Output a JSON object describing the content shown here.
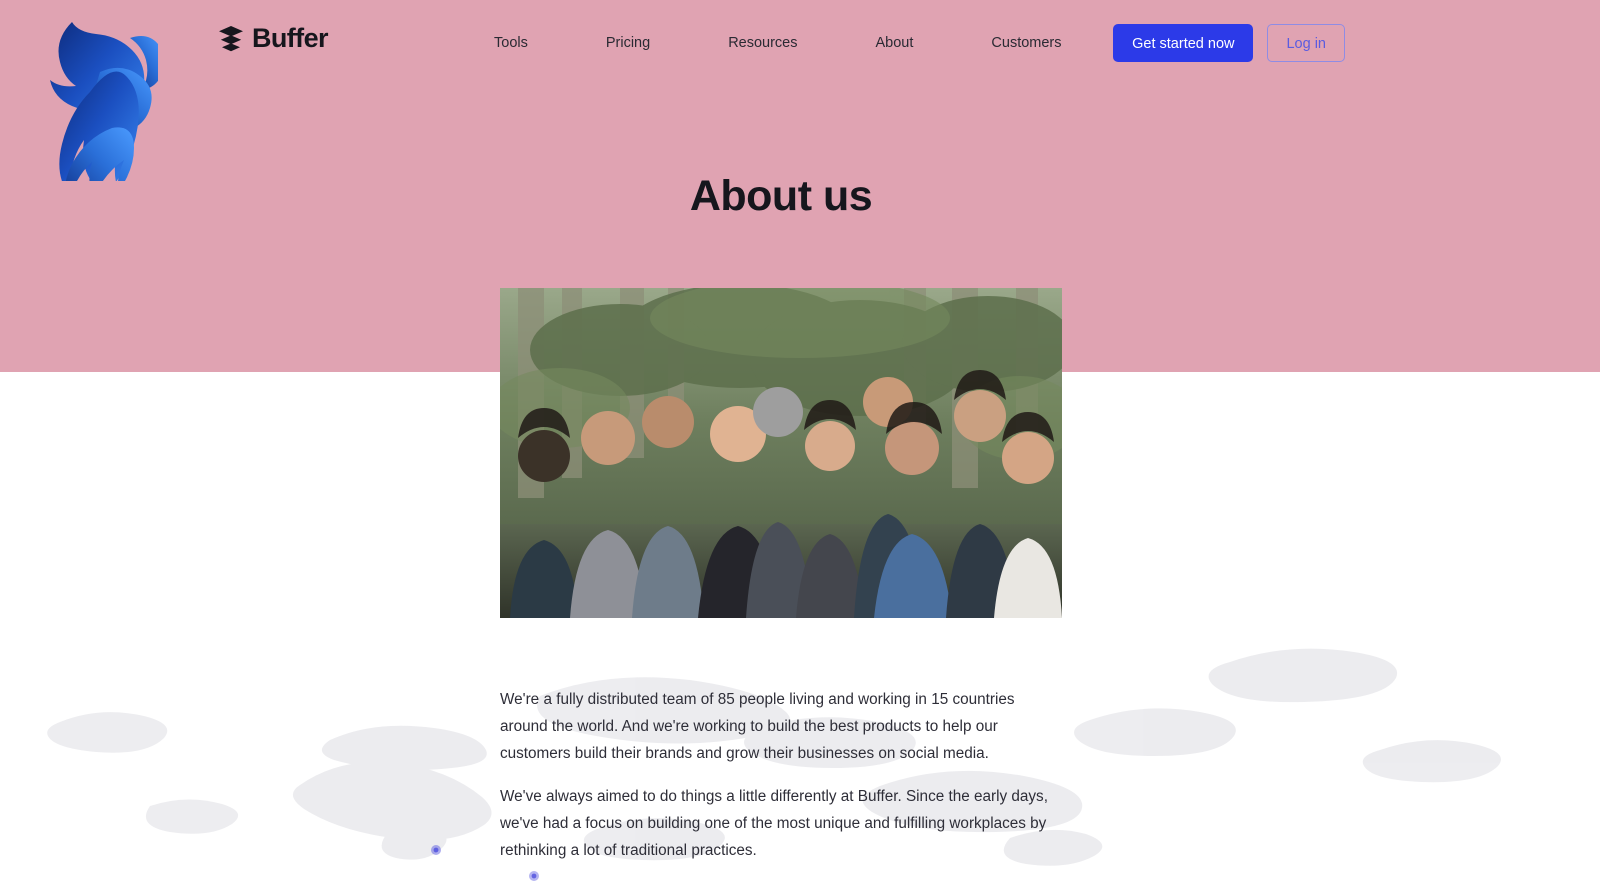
{
  "colors": {
    "hero_background": "#e0a3b2",
    "page_background": "#ffffff",
    "primary_button": "#2c3ae8",
    "outline_button_text": "#5b5ce0",
    "outline_button_border": "#8f8ce4",
    "heading_text": "#16161d",
    "body_text": "#2e2e38",
    "logo_gradient_start": "#0d2a7a",
    "logo_gradient_end": "#2f80ef",
    "map_dot": "#5b5ce0"
  },
  "branding": {
    "bull_logo_icon": "bull-head-logo-icon",
    "logo_mark_icon": "buffer-stacked-layers-icon",
    "name": "Buffer"
  },
  "nav": {
    "items": [
      {
        "label": "Tools"
      },
      {
        "label": "Pricing"
      },
      {
        "label": "Resources"
      },
      {
        "label": "About"
      },
      {
        "label": "Customers"
      }
    ],
    "cta_primary": "Get started now",
    "cta_secondary": "Log in"
  },
  "hero": {
    "title": "About us",
    "photo_alt": "team-group-photo"
  },
  "main": {
    "paragraphs": [
      "We're a fully distributed team of 85 people living and working in 15 countries around the world. And we're working to build the best products to help our customers build their brands and grow their businesses on social media.",
      "We've always aimed to do things a little differently at Buffer. Since the early days, we've had a focus on building one of the most unique and fulfilling workplaces by rethinking a lot of traditional practices."
    ]
  }
}
